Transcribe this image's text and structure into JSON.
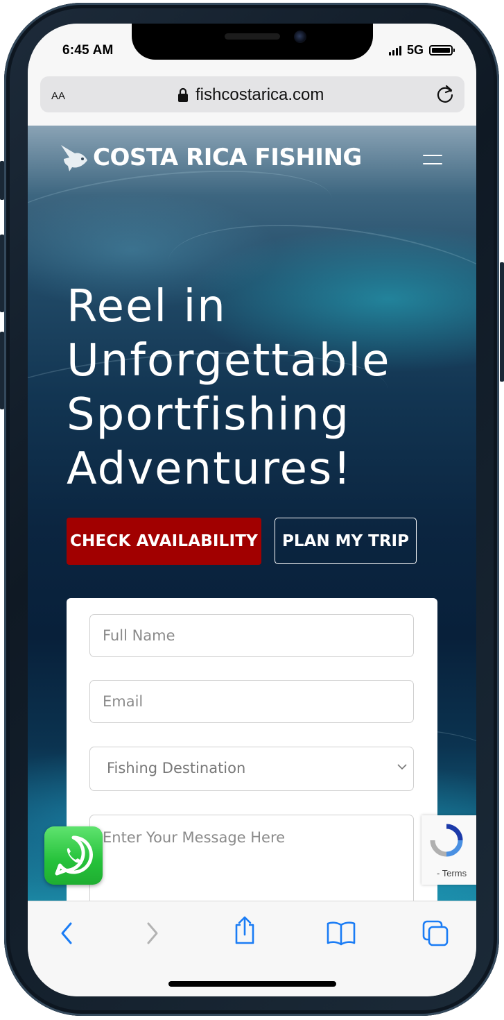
{
  "status_bar": {
    "time": "6:45 AM",
    "network": "5G"
  },
  "browser": {
    "text_size_label": "AA",
    "url": "fishcostarica.com",
    "icons": [
      "lock-icon",
      "reload-icon",
      "back-icon",
      "forward-icon",
      "share-icon",
      "bookmarks-icon",
      "tabs-icon"
    ]
  },
  "site": {
    "logo_text": "COSTA RICA FISHING",
    "hero_title_lines": [
      "Reel in",
      "Unforgettable",
      "Sportfishing",
      "Adventures!"
    ],
    "buttons": {
      "check_availability": "CHECK AVAILABILITY",
      "plan_trip": "PLAN MY TRIP"
    },
    "form": {
      "full_name_placeholder": "Full Name",
      "email_placeholder": "Email",
      "destination_selected": "Fishing Destination",
      "message_placeholder": "Enter Your Message Here"
    },
    "recaptcha_terms": "- Terms"
  },
  "colors": {
    "primary_button": "#a10000",
    "whatsapp": "#25c13a",
    "ios_blue": "#1a7cf5"
  }
}
